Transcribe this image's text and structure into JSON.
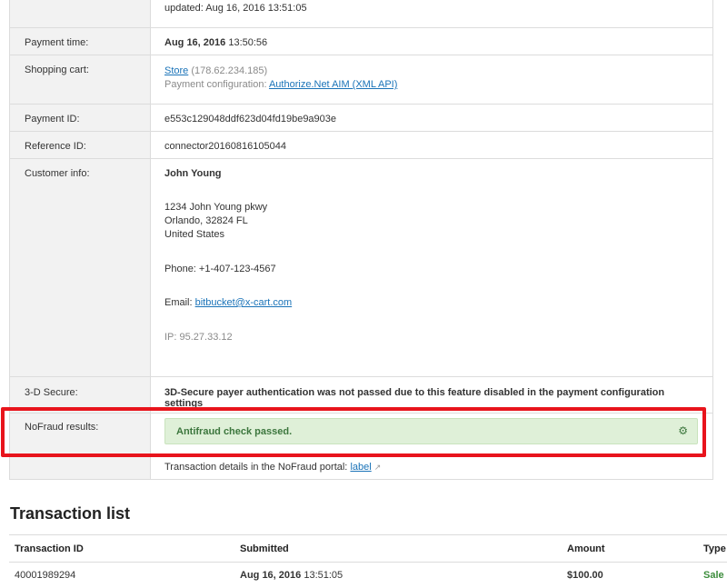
{
  "details": {
    "updated_text": "updated: Aug 16, 2016 13:51:05",
    "payment_time": {
      "label": "Payment time:",
      "date": "Aug 16, 2016",
      "time": "13:50:56"
    },
    "shopping_cart": {
      "label": "Shopping cart:",
      "store_link": "Store",
      "store_ip": "(178.62.234.185)",
      "config_prefix": "Payment configuration:",
      "config_link": "Authorize.Net AIM (XML API)"
    },
    "payment_id": {
      "label": "Payment ID:",
      "value": "e553c129048ddf623d04fd19be9a903e"
    },
    "reference_id": {
      "label": "Reference ID:",
      "value": "connector20160816105044"
    },
    "customer_info": {
      "label": "Customer info:",
      "name": "John Young",
      "address_line1": "1234 John Young pkwy",
      "address_line2": "Orlando, 32824 FL",
      "address_line3": "United States",
      "phone": "Phone: +1-407-123-4567",
      "email_prefix": "Email:",
      "email": "bitbucket@x-cart.com",
      "ip": "IP: 95.27.33.12"
    },
    "three_d_secure": {
      "label": "3-D Secure:",
      "message": "3D-Secure payer authentication was not passed due to this feature disabled in the payment configuration settings"
    },
    "nofraud": {
      "label": "NoFraud results:",
      "result": "Antifraud check passed.",
      "portal_prefix": "Transaction details in the NoFraud portal:",
      "portal_link": "label"
    }
  },
  "transactions": {
    "title": "Transaction list",
    "columns": [
      "Transaction ID",
      "Submitted",
      "Amount",
      "Type"
    ],
    "rows": [
      {
        "id": "40001989294",
        "date": "Aug 16, 2016",
        "time": "13:51:05",
        "amount": "$100.00",
        "type": "Sale"
      }
    ]
  },
  "icons": {
    "settings": "gear-icon",
    "external": "external-link-icon"
  },
  "colors": {
    "highlight": "#e8141c",
    "success_bg": "#dff0d8",
    "success_text": "#3c763d",
    "warning": "#b6893a",
    "link": "#1a73b8"
  }
}
